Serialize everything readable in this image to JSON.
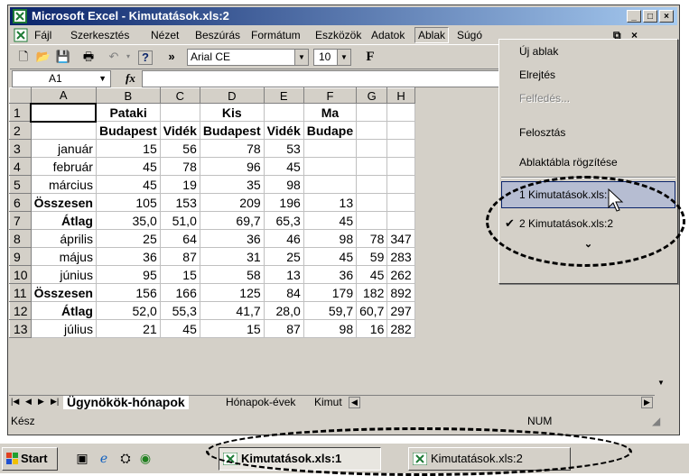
{
  "window": {
    "title": "Microsoft Excel - Kimutatások.xls:2"
  },
  "menubar": {
    "items": [
      "Fájl",
      "Szerkesztés",
      "Nézet",
      "Beszúrás",
      "Formátum",
      "Eszközök",
      "Adatok",
      "Ablak",
      "Súgó"
    ],
    "active": "Ablak"
  },
  "toolbar": {
    "font_name": "Arial CE",
    "font_size": "10",
    "bold_label": "F"
  },
  "formula_bar": {
    "name_box": "A1",
    "fx_label": "fx",
    "value": ""
  },
  "sheet": {
    "columns": [
      "A",
      "B",
      "C",
      "D",
      "E",
      "F",
      "G",
      "H"
    ],
    "rows": [
      {
        "n": "1",
        "cells": [
          "",
          "Pataki",
          "",
          "Kis",
          "",
          "Ma",
          "",
          ""
        ]
      },
      {
        "n": "2",
        "cells": [
          "",
          "Budapest",
          "Vidék",
          "Budapest",
          "Vidék",
          "Budape",
          "",
          ""
        ]
      },
      {
        "n": "3",
        "cells": [
          "január",
          "15",
          "56",
          "78",
          "53",
          "",
          "",
          ""
        ]
      },
      {
        "n": "4",
        "cells": [
          "február",
          "45",
          "78",
          "96",
          "45",
          "",
          "",
          ""
        ]
      },
      {
        "n": "5",
        "cells": [
          "március",
          "45",
          "19",
          "35",
          "98",
          "",
          "",
          ""
        ]
      },
      {
        "n": "6",
        "cells": [
          "Összesen",
          "105",
          "153",
          "209",
          "196",
          "13",
          "",
          ""
        ]
      },
      {
        "n": "7",
        "cells": [
          "Átlag",
          "35,0",
          "51,0",
          "69,7",
          "65,3",
          "45",
          "",
          ""
        ]
      },
      {
        "n": "8",
        "cells": [
          "április",
          "25",
          "64",
          "36",
          "46",
          "98",
          "78",
          "347"
        ]
      },
      {
        "n": "9",
        "cells": [
          "május",
          "36",
          "87",
          "31",
          "25",
          "45",
          "59",
          "283"
        ]
      },
      {
        "n": "10",
        "cells": [
          "június",
          "95",
          "15",
          "58",
          "13",
          "36",
          "45",
          "262"
        ]
      },
      {
        "n": "11",
        "cells": [
          "Összesen",
          "156",
          "166",
          "125",
          "84",
          "179",
          "182",
          "892"
        ]
      },
      {
        "n": "12",
        "cells": [
          "Átlag",
          "52,0",
          "55,3",
          "41,7",
          "28,0",
          "59,7",
          "60,7",
          "297"
        ]
      },
      {
        "n": "13",
        "cells": [
          "július",
          "21",
          "45",
          "15",
          "87",
          "98",
          "16",
          "282"
        ]
      }
    ]
  },
  "sheet_tabs": [
    "Ügynökök-hónapok",
    "Hónapok-évek",
    "Kimut"
  ],
  "status": {
    "left": "Kész",
    "num": "NUM"
  },
  "window_menu": {
    "items": [
      {
        "label": "Új ablak",
        "disabled": false
      },
      {
        "label": "Elrejtés",
        "disabled": false
      },
      {
        "label": "Felfedés...",
        "disabled": true
      },
      {
        "label": "Felosztás",
        "disabled": false
      },
      {
        "label": "Ablaktábla rögzítése",
        "disabled": false
      },
      {
        "label": "1 Kimutatások.xls:1",
        "disabled": false
      },
      {
        "label": "2 Kimutatások.xls:2",
        "disabled": false
      }
    ],
    "highlight_color": "#b6bdd2"
  },
  "taskbar": {
    "start": "Start",
    "items": [
      "Kimutatások.xls:1",
      "Kimutatások.xls:2"
    ]
  }
}
